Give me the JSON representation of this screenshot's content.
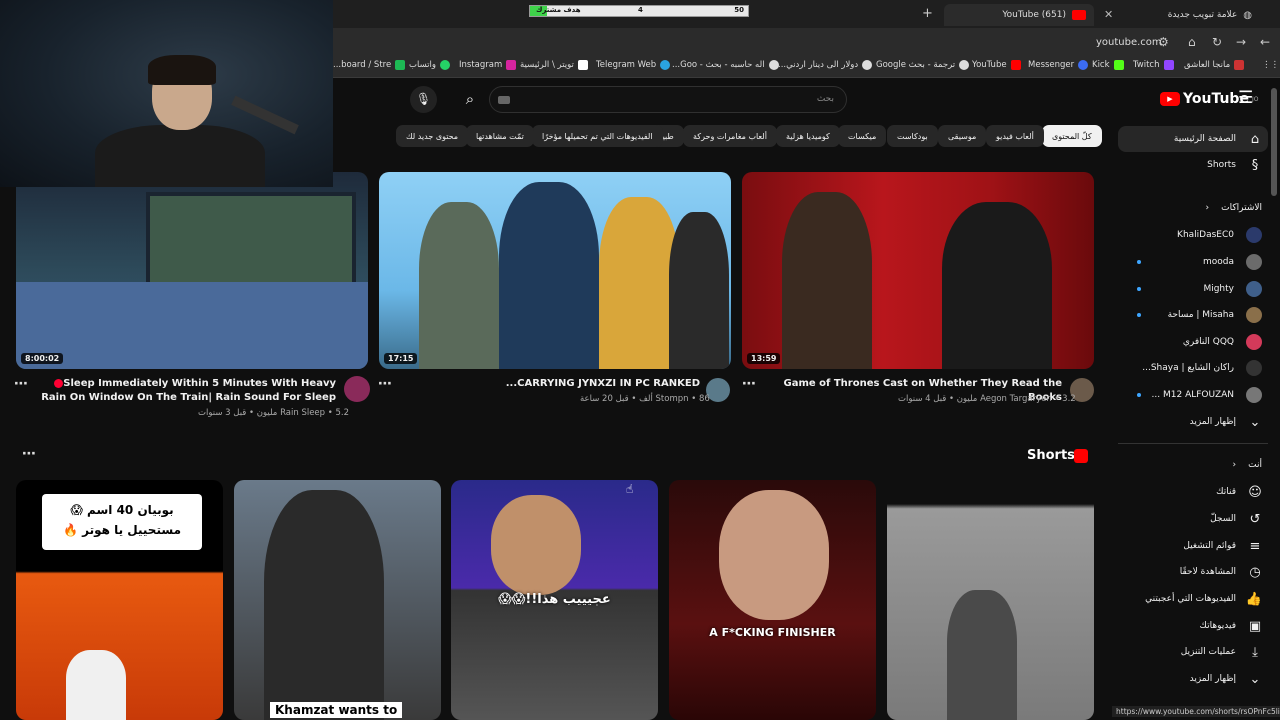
{
  "browser": {
    "tabs": [
      {
        "title": "(651) YouTube",
        "active": true
      },
      {
        "title": "علامة تبويب جديدة",
        "active": false
      }
    ],
    "new_tab_symbol": "+",
    "url": "youtube.com",
    "goal_bar": {
      "label": "هدف مشترك",
      "current": "4",
      "target": "50",
      "progress": 0.08
    },
    "bookmarks": [
      "مانجا العاشق",
      "Twitch",
      "Kick",
      "Messenger",
      "YouTube",
      "ترجمة - بحث Google",
      "دولار الى دينار اردني...",
      "اله حاسبه - بحث - Goo...",
      "Telegram Web",
      "تويتر \\ الرئيسية",
      "Instagram",
      "واتساب",
      "board / Stre..."
    ],
    "status_url": "https://www.youtube.com/shorts/rsOPnFc5lio"
  },
  "youtube": {
    "logo_text": "YouTube",
    "logo_sup": "JO",
    "search_placeholder": "بحث",
    "chips": [
      "كلّ المحتوى",
      "ألعاب فيديو",
      "موسيقى",
      "بودكاست",
      "ميكسات",
      "كوميديا هزلية",
      "ألعاب مغامرات وحركة",
      "طبيعية",
      "الفيديوهات التي تم تحميلها مؤخرًا",
      "تمّت مشاهدتها",
      "محتوى جديد لك"
    ]
  },
  "sidebar": {
    "main": [
      {
        "label": "الصفحة الرئيسية",
        "icon": "home-icon"
      },
      {
        "label": "Shorts",
        "icon": "shorts-icon"
      }
    ],
    "subs_header": "الاشتراكات",
    "subscriptions": [
      {
        "label": "KhaliDasEC0",
        "dot": false
      },
      {
        "label": "mooda",
        "dot": true
      },
      {
        "label": "Mighty",
        "dot": true
      },
      {
        "label": "Misaha | مساحة",
        "dot": true
      },
      {
        "label": "QQQ النافري",
        "dot": false
      },
      {
        "label": "راكان الشايع | Shaya...",
        "dot": false
      },
      {
        "label": "M12 ALFOUZAN ...",
        "dot": true
      }
    ],
    "subs_more": "إظهار المزيد",
    "you_header": "أنت",
    "you_items": [
      {
        "label": "قناتك",
        "icon": "account-icon"
      },
      {
        "label": "السجلّ",
        "icon": "history-icon"
      },
      {
        "label": "قوائم التشغيل",
        "icon": "playlist-icon"
      },
      {
        "label": "المشاهدة لاحقًا",
        "icon": "clock-icon"
      },
      {
        "label": "الفيديوهات التي أعجبتني",
        "icon": "like-icon"
      },
      {
        "label": "فيديوهاتك",
        "icon": "video-icon"
      },
      {
        "label": "عمليات التنزيل",
        "icon": "download-icon"
      },
      {
        "label": "إظهار المزيد",
        "icon": "chevron-down-icon"
      }
    ]
  },
  "videos": [
    {
      "title": "Game of Thrones Cast on Whether They Read the Books",
      "channel": "Aegon Targaryen",
      "views": "3.2 مليون",
      "age": "قبل 4 سنوات",
      "duration": "13:59"
    },
    {
      "title": "CARRYING JYNXZI IN PC RANKED...",
      "channel": "Stompn",
      "views": "86 ألف",
      "age": "قبل 20 ساعة",
      "duration": "17:15"
    },
    {
      "title": "Sleep Immediately Within 5 Minutes With Heavy Rain On Window On The Train| Rain Sound For Sleep",
      "channel": "Rain Sleep",
      "views": "5.2 مليون",
      "age": "قبل 3 سنوات",
      "duration": "8:00:02"
    }
  ],
  "shorts": {
    "heading": "Shorts",
    "items": [
      {
        "caption": ""
      },
      {
        "caption": ""
      },
      {
        "caption": "عجيييب هذا!!😱😱"
      },
      {
        "caption": "A F*CKING FINISHER"
      },
      {
        "caption": "Khamzat wants to"
      }
    ],
    "first_caption": "بوبيان 40 اسم 😱 مستحييل يا هوتر 🔥"
  }
}
